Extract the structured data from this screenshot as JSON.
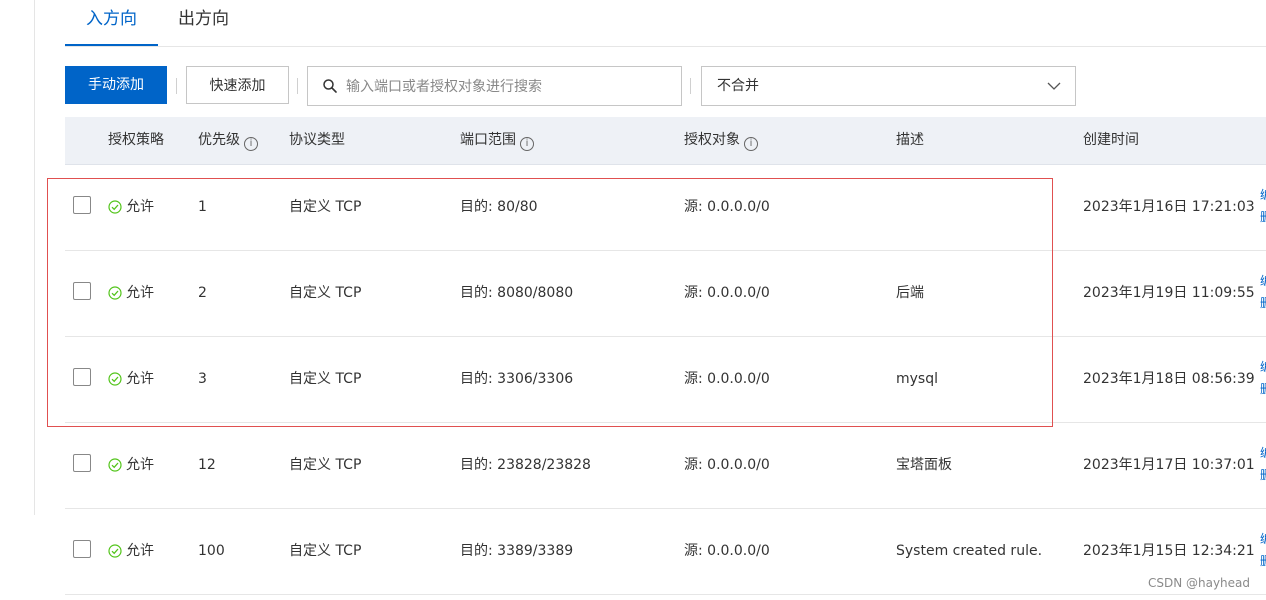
{
  "tabs": [
    {
      "label": "入方向",
      "active": true
    },
    {
      "label": "出方向",
      "active": false
    }
  ],
  "toolbar": {
    "manual_add": "手动添加",
    "quick_add": "快速添加",
    "search_placeholder": "输入端口或者授权对象进行搜索",
    "merge_select": "不合并"
  },
  "table": {
    "headers": [
      "授权策略",
      "优先级",
      "协议类型",
      "端口范围",
      "授权对象",
      "描述",
      "创建时间"
    ],
    "rows": [
      {
        "policy": "允许",
        "priority": "1",
        "protocol": "自定义 TCP",
        "port": "目的: 80/80",
        "source": "源: 0.0.0.0/0",
        "desc": "",
        "created": "2023年1月16日 17:21:03"
      },
      {
        "policy": "允许",
        "priority": "2",
        "protocol": "自定义 TCP",
        "port": "目的: 8080/8080",
        "source": "源: 0.0.0.0/0",
        "desc": "后端",
        "created": "2023年1月19日 11:09:55"
      },
      {
        "policy": "允许",
        "priority": "3",
        "protocol": "自定义 TCP",
        "port": "目的: 3306/3306",
        "source": "源: 0.0.0.0/0",
        "desc": "mysql",
        "created": "2023年1月18日 08:56:39"
      },
      {
        "policy": "允许",
        "priority": "12",
        "protocol": "自定义 TCP",
        "port": "目的: 23828/23828",
        "source": "源: 0.0.0.0/0",
        "desc": "宝塔面板",
        "created": "2023年1月17日 10:37:01"
      },
      {
        "policy": "允许",
        "priority": "100",
        "protocol": "自定义 TCP",
        "port": "目的: 3389/3389",
        "source": "源: 0.0.0.0/0",
        "desc": "System created rule.",
        "created": "2023年1月15日 12:34:21"
      }
    ]
  },
  "watermark": "CSDN @hayhead",
  "colors": {
    "accent": "#0064c8",
    "success": "#52c41a",
    "highlight_border": "#e05050",
    "header_bg": "#eef1f6"
  }
}
